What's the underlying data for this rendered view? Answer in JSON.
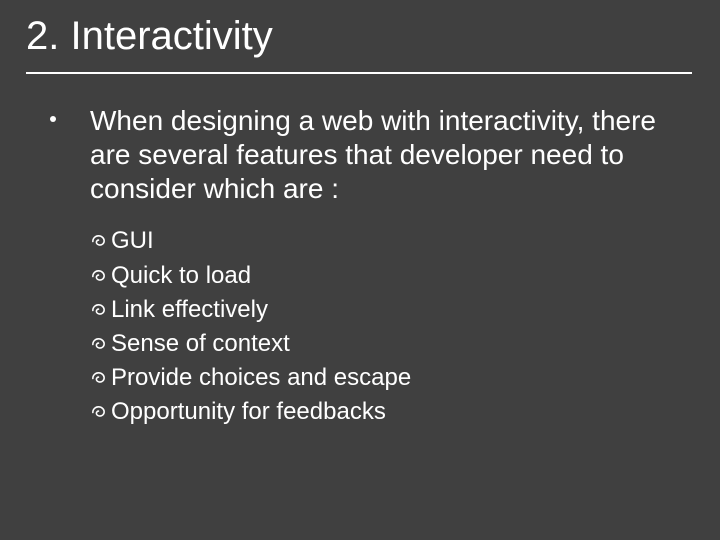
{
  "title": "2. Interactivity",
  "intro": "When designing a web with interactivity, there are several features that developer need to consider which are :",
  "features": [
    "GUI",
    "Quick to load",
    "Link effectively",
    "Sense of context",
    "Provide choices and escape",
    "Opportunity for feedbacks"
  ]
}
